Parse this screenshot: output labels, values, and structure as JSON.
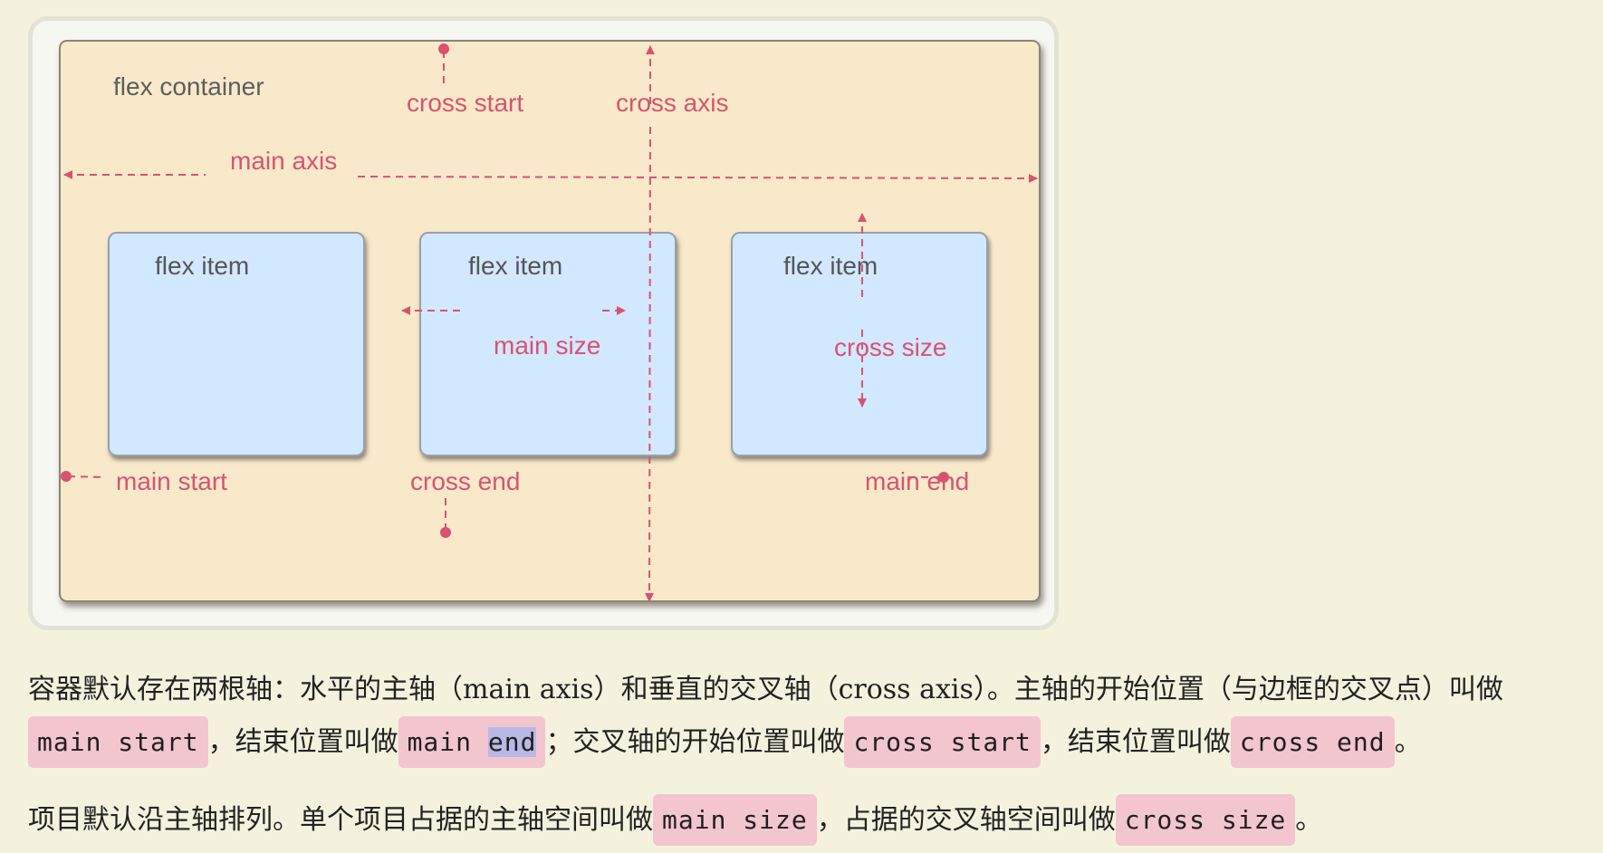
{
  "diagram": {
    "container_label": "flex container",
    "labels": {
      "cross_start": "cross start",
      "cross_axis": "cross axis",
      "main_axis": "main axis",
      "main_start": "main start",
      "cross_end": "cross end",
      "main_end": "main end"
    },
    "items": [
      {
        "label": "flex item"
      },
      {
        "label": "flex item",
        "annotation": "main size"
      },
      {
        "label": "flex item",
        "annotation": "cross size"
      }
    ],
    "colors": {
      "container_fill": "#f8e9cb",
      "item_fill": "#d2e8ff",
      "annotation": "#d9536f",
      "page_background": "#f4f2dd"
    }
  },
  "paragraph1": {
    "text_a": "容器默认存在两根轴：水平的主轴（main axis）和垂直的交叉轴（cross axis）。主轴的开始位置（与边框的交叉点）叫做",
    "code_main_start": "main start",
    "text_b": "，结束位置叫做",
    "code_main_end_part1": "main ",
    "code_main_end_part2": "end",
    "text_c": "；交叉轴的开始位置叫做",
    "code_cross_start": "cross start",
    "text_d": "，结束位置叫做",
    "code_cross_end": "cross end",
    "text_e": "。"
  },
  "paragraph2": {
    "text_a": "项目默认沿主轴排列。单个项目占据的主轴空间叫做",
    "code_main_size": "main size",
    "text_b": "，占据的交叉轴空间叫做",
    "code_cross_size": "cross size",
    "text_c": "。"
  }
}
